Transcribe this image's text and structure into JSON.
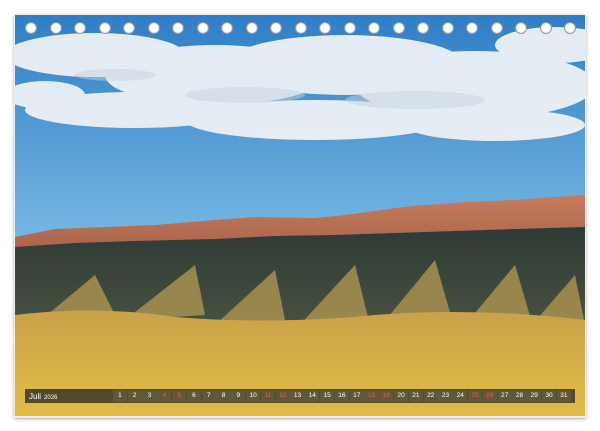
{
  "calendar": {
    "month": "Juli",
    "year": "2026",
    "days": [
      "1",
      "2",
      "3",
      "4",
      "5",
      "6",
      "7",
      "8",
      "9",
      "10",
      "11",
      "12",
      "13",
      "14",
      "15",
      "16",
      "17",
      "18",
      "19",
      "20",
      "21",
      "22",
      "23",
      "24",
      "25",
      "26",
      "27",
      "28",
      "29",
      "30",
      "31"
    ],
    "weekend_days": [
      "4",
      "5",
      "11",
      "12",
      "18",
      "19",
      "25",
      "26"
    ]
  },
  "colors": {
    "sky_top": "#3c86c9",
    "sky_bottom": "#6fb2e0",
    "cliff": "#b66a4c",
    "mountain_dark": "#3d4a3f",
    "grass": "#d9b34b",
    "calendar_strip": "#1e1e1e",
    "weekend": "#e95a5a"
  },
  "photo": {
    "subject": "mountain-landscape"
  }
}
